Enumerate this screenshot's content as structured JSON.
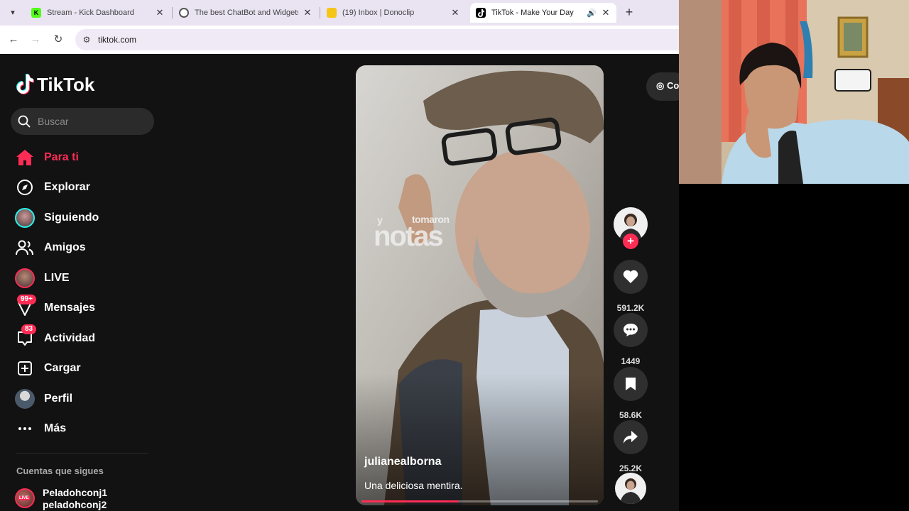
{
  "browser": {
    "tabs": [
      {
        "title": "Stream - Kick Dashboard",
        "favicon_color": "#53fc18",
        "favicon_letter": "K"
      },
      {
        "title": "The best ChatBot and Widgets",
        "favicon_color": "#ffffff",
        "favicon_letter": ""
      },
      {
        "title": "(19) Inbox | Donoclip",
        "favicon_color": "#f5c518",
        "favicon_letter": ""
      },
      {
        "title": "TikTok - Make Your Day",
        "favicon_color": "#000000",
        "favicon_letter": ""
      }
    ],
    "active_tab": 3,
    "url": "tiktok.com"
  },
  "tiktok": {
    "logo_text": "TikTok",
    "search_placeholder": "Buscar",
    "nav": [
      {
        "label": "Para ti",
        "icon": "home-icon",
        "active": true
      },
      {
        "label": "Explorar",
        "icon": "compass-icon"
      },
      {
        "label": "Siguiendo",
        "icon": "following-avatar-icon"
      },
      {
        "label": "Amigos",
        "icon": "friends-icon"
      },
      {
        "label": "LIVE",
        "icon": "live-avatar-icon"
      },
      {
        "label": "Mensajes",
        "icon": "messages-icon",
        "badge": "99+"
      },
      {
        "label": "Actividad",
        "icon": "activity-icon",
        "badge": "83"
      },
      {
        "label": "Cargar",
        "icon": "upload-icon"
      },
      {
        "label": "Perfil",
        "icon": "profile-avatar-icon"
      },
      {
        "label": "Más",
        "icon": "more-icon"
      }
    ],
    "following_title": "Cuentas que sigues",
    "followed": {
      "live_tag": "LIVE",
      "name1": "Peladohconj1",
      "name2": "peladohconj2"
    },
    "video": {
      "overlay_y": "y",
      "overlay_tomaron": "tomaron",
      "overlay_notas": "notas",
      "author": "julianealborna",
      "caption": "Una deliciosa mentira.",
      "progress": 0.41
    },
    "actions": {
      "likes": "591.2K",
      "comments": "1449",
      "saves": "58.6K",
      "shares": "25.2K"
    },
    "coins_label": "Co"
  },
  "colors": {
    "accent": "#fe2c55",
    "background": "#121212"
  }
}
